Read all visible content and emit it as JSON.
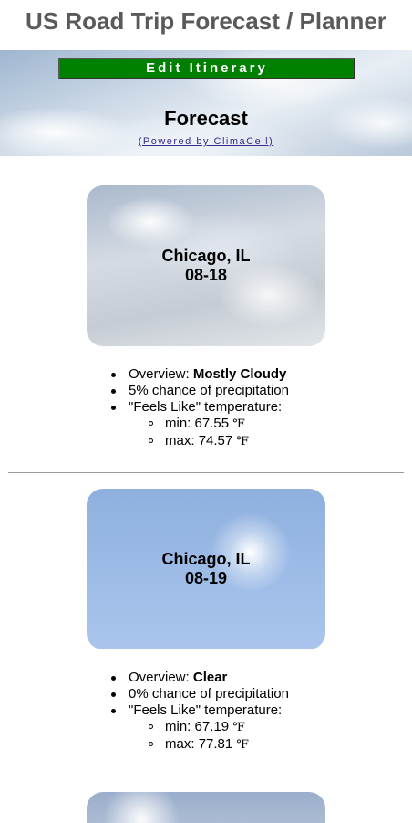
{
  "header": {
    "title": "US Road Trip Forecast / Planner"
  },
  "hero": {
    "edit_button_label": "Edit Itinerary",
    "section_title": "Forecast",
    "powered_by": "(Powered by ClimaCell)"
  },
  "labels": {
    "overview_prefix": "Overview: ",
    "precip_suffix": " chance of precipitation",
    "feels_like": "\"Feels Like\" temperature:",
    "min_prefix": "min: ",
    "max_prefix": "max: ",
    "temp_unit": "℉"
  },
  "days": [
    {
      "city": "Chicago, IL",
      "date": "08-18",
      "overview": "Mostly Cloudy",
      "precip": "5%",
      "min": "67.55",
      "max": "74.57",
      "card_style": "cloudy"
    },
    {
      "city": "Chicago, IL",
      "date": "08-19",
      "overview": "Clear",
      "precip": "0%",
      "min": "67.19",
      "max": "77.81",
      "card_style": "clear"
    }
  ]
}
